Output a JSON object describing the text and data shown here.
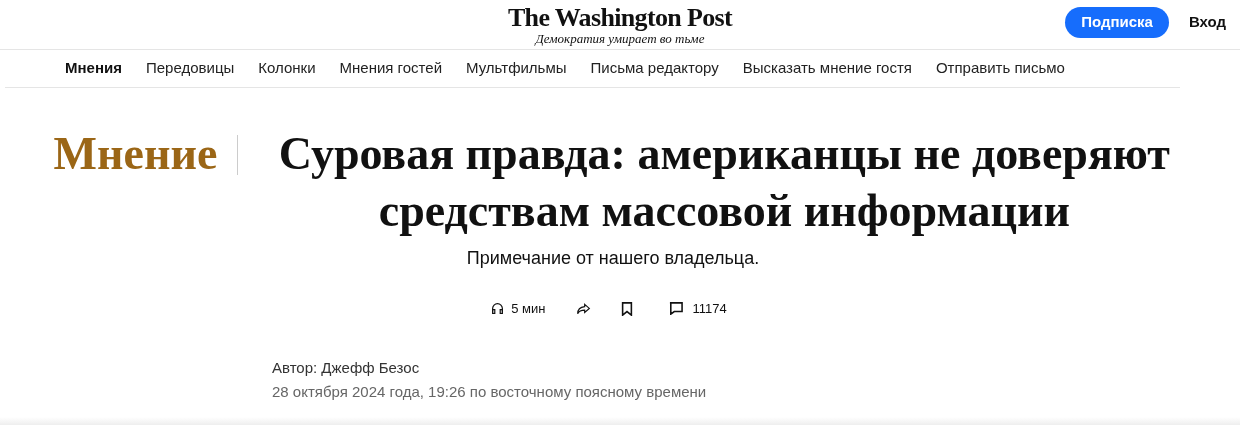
{
  "header": {
    "logo": "The Washington Post",
    "tagline": "Демократия умирает во тьме",
    "subscribe_button": "Подписка",
    "login_link": "Вход"
  },
  "nav": [
    {
      "label": "Мнения",
      "selected": true
    },
    {
      "label": "Передовицы",
      "selected": false
    },
    {
      "label": "Колонки",
      "selected": false
    },
    {
      "label": "Мнения гостей",
      "selected": false
    },
    {
      "label": "Мультфильмы",
      "selected": false
    },
    {
      "label": "Письма редактору",
      "selected": false
    },
    {
      "label": "Высказать мнение гостя",
      "selected": false
    },
    {
      "label": "Отправить письмо",
      "selected": false
    }
  ],
  "article": {
    "section": "Мнение",
    "headline": "Суровая правда: американцы не доверяют средствам массовой информации",
    "subtitle": "Примечание от нашего владельца.",
    "listen_time": "5 мин",
    "comment_count": "11174",
    "byline": "Автор: Джефф Безос",
    "dateline": "28 октября 2024 года, 19:26 по восточному поясному времени"
  }
}
